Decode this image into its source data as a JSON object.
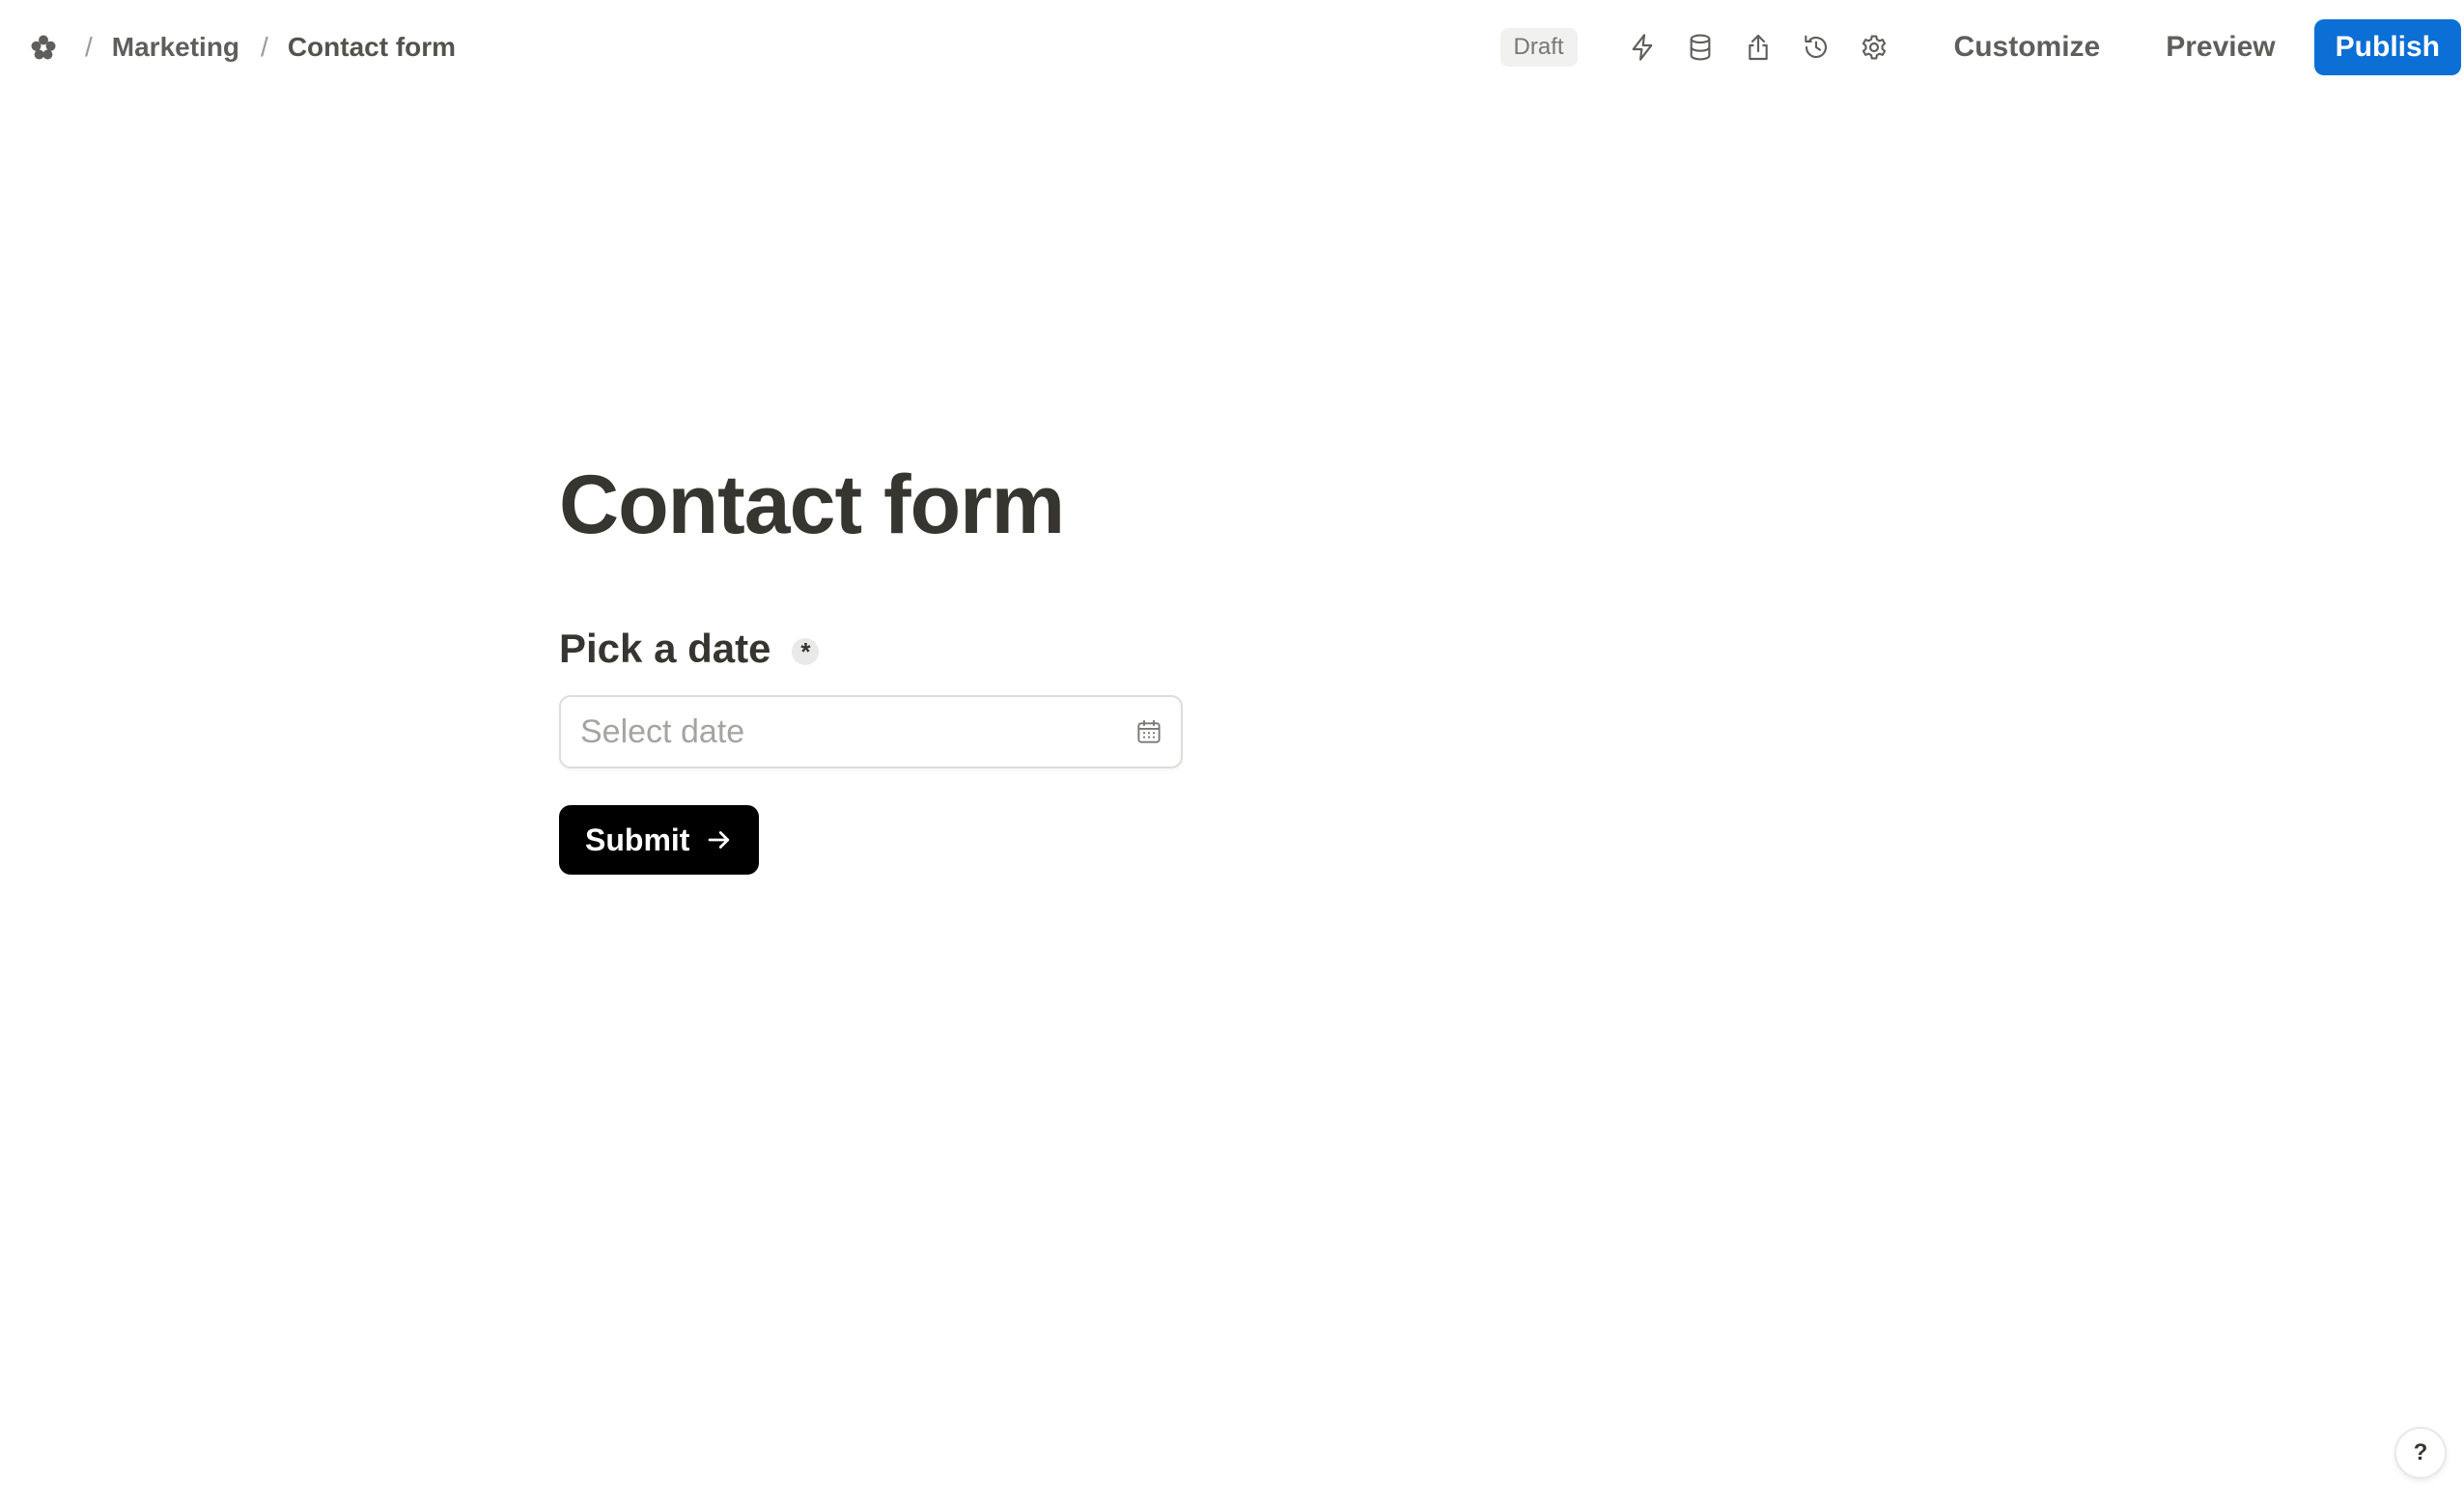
{
  "breadcrumb": {
    "logo_icon": "workspace-flower-icon",
    "separator": "/",
    "items": [
      "Marketing",
      "Contact form"
    ]
  },
  "toolbar": {
    "status": "Draft",
    "icons": [
      "bolt-icon",
      "database-icon",
      "share-icon",
      "history-icon",
      "gear-icon"
    ],
    "customize_label": "Customize",
    "preview_label": "Preview",
    "publish_label": "Publish",
    "publish_color": "#0b6fd6"
  },
  "form": {
    "title": "Contact form",
    "field": {
      "label": "Pick a date",
      "required_marker": "*",
      "placeholder": "Select date",
      "icon": "calendar-icon"
    },
    "submit_label": "Submit"
  },
  "help": {
    "label": "?"
  }
}
